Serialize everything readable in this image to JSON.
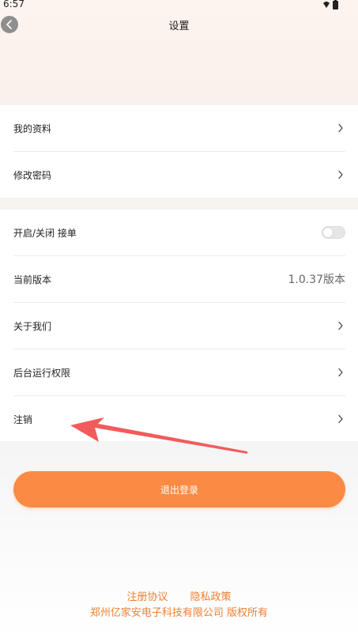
{
  "status_bar": {
    "time": "6:57",
    "icons": [
      "wifi-icon",
      "battery-icon"
    ]
  },
  "header": {
    "title": "设置",
    "back_icon": "chevron-left-icon"
  },
  "groups": [
    {
      "rows": [
        {
          "label": "我的资料",
          "accessory": "chevron-right-icon"
        },
        {
          "label": "修改密码",
          "accessory": "chevron-right-icon"
        }
      ]
    },
    {
      "rows": [
        {
          "label": "开启/关闭 接单",
          "accessory": "toggle",
          "toggle_on": false
        },
        {
          "label": "当前版本",
          "value": "1.0.37版本"
        },
        {
          "label": "关于我们",
          "accessory": "chevron-right-icon"
        },
        {
          "label": "后台运行权限",
          "accessory": "chevron-right-icon"
        },
        {
          "label": "注销",
          "accessory": "chevron-right-icon"
        }
      ]
    }
  ],
  "logout": {
    "label": "退出登录"
  },
  "footer": {
    "links": [
      "注册协议",
      "隐私政策"
    ],
    "copyright": "郑州亿家安电子科技有限公司 版权所有"
  },
  "colors": {
    "accent": "#fb8b44",
    "footer_text": "#f07f2e",
    "annotation_arrow": "#f25b5b"
  }
}
